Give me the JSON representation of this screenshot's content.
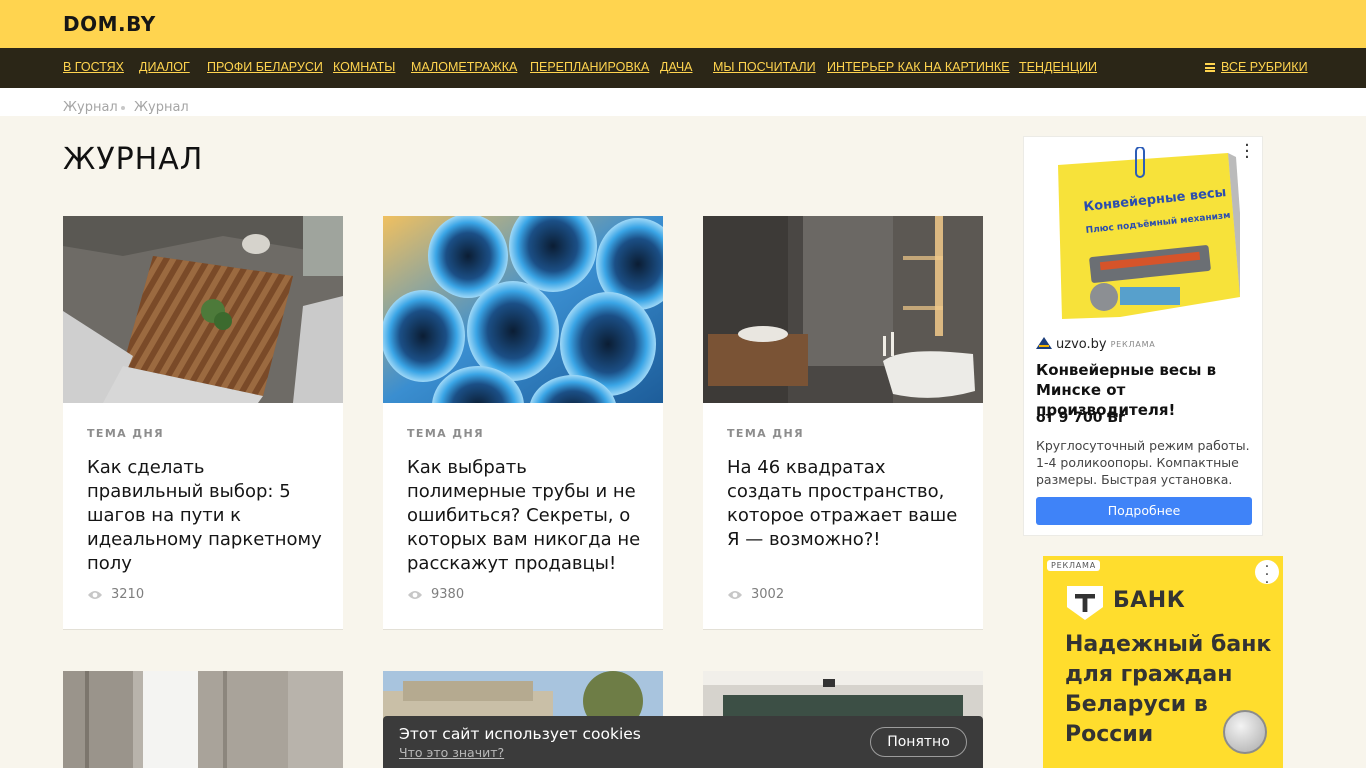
{
  "header": {
    "logo": "DOM.BY"
  },
  "nav": {
    "items": [
      "В ГОСТЯХ",
      "ДИАЛОГ",
      "ПРОФИ БЕЛАРУСИ",
      "КОМНАТЫ",
      "МАЛОМЕТРАЖКА",
      "ПЕРЕПЛАНИРОВКА",
      "ДАЧА",
      "МЫ ПОСЧИТАЛИ",
      "ИНТЕРЬЕР КАК НА КАРТИНКЕ",
      "ТЕНДЕНЦИИ"
    ],
    "all_rubrics": "ВСЕ РУБРИКИ"
  },
  "breadcrumb": [
    "Журнал",
    "Журнал"
  ],
  "page": {
    "title": "ЖУРНАЛ"
  },
  "cards": [
    {
      "tag": "ТЕМА ДНЯ",
      "title": "Как сделать правильный выбор: 5 шагов на пути к идеальному паркетному полу",
      "views": "3210"
    },
    {
      "tag": "ТЕМА ДНЯ",
      "title": "Как выбрать полимерные трубы и не ошибиться? Секреты, о которых вам никогда не расскажут продавцы!",
      "views": "9380"
    },
    {
      "tag": "ТЕМА ДНЯ",
      "title": "На 46 квадратах создать пространство, которое отражает ваше Я — возможно?!",
      "views": "3002"
    }
  ],
  "ad1": {
    "domain": "uzvo.by",
    "ad_label": "РЕКЛАМА",
    "sticky_title": "Конвейерные весы",
    "sticky_sub": "Плюс подъёмный механизм",
    "title": "Конвейерные весы в Мин­ске от производителя!",
    "price": "от 9 700 Br",
    "description": "Круглосуточный режим работы. 1-4 роликоопоры. Компактные размеры. Быстрая установка.",
    "button": "Подробнее"
  },
  "ad2": {
    "ad_label": "РЕКЛАМА",
    "brand": "БАНК",
    "slogan": "Надежный банк для граждан Беларуси в России"
  },
  "cookie": {
    "text": "Этот сайт использует cookies",
    "link": "Что это значит?",
    "button": "Понятно"
  }
}
